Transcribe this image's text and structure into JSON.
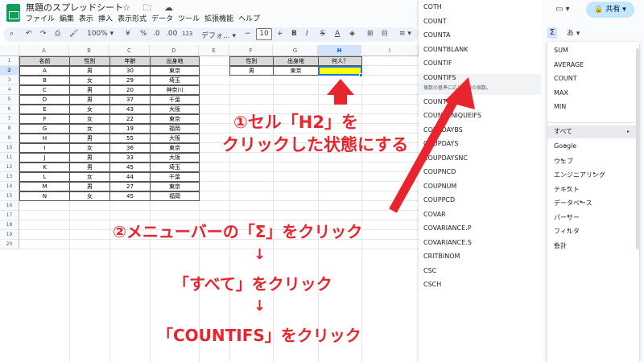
{
  "doc": {
    "title": "無題のスプレッドシート",
    "title_icons": "☆ 🗀 ☁",
    "menus": [
      "ファイル",
      "編集",
      "表示",
      "挿入",
      "表示形式",
      "データ",
      "ツール",
      "拡張機能",
      "ヘルプ"
    ]
  },
  "toolbar": {
    "search_icon": "search-icon",
    "undo": "↶",
    "redo": "↷",
    "zoom": "100%",
    "currency": "¥",
    "percent": "%",
    "dec_minus": ".0",
    "dec_plus": ".00",
    "number_fmt": "123",
    "font": "デフォ...",
    "font_size": "10",
    "minus": "−",
    "plus": "+",
    "bold": "B",
    "italic": "I",
    "strike": "S",
    "text_color": "A"
  },
  "grid": {
    "columns": [
      "A",
      "B",
      "C",
      "D",
      "E",
      "F",
      "G",
      "H",
      "I"
    ],
    "rows": [
      "1",
      "2",
      "3",
      "4",
      "5",
      "6",
      "7",
      "8",
      "9",
      "10",
      "11",
      "12",
      "13",
      "14",
      "15",
      "16",
      "17",
      "18",
      "19",
      "20"
    ],
    "active_column": "H",
    "active_row": "2"
  },
  "table": {
    "headers": [
      "名前",
      "性別",
      "年齢",
      "出身地"
    ],
    "rows": [
      [
        "A",
        "男",
        "30",
        "東京"
      ],
      [
        "B",
        "女",
        "29",
        "埼玉"
      ],
      [
        "C",
        "男",
        "20",
        "神奈川"
      ],
      [
        "D",
        "男",
        "37",
        "千葉"
      ],
      [
        "E",
        "女",
        "43",
        "大阪"
      ],
      [
        "F",
        "女",
        "22",
        "東京"
      ],
      [
        "G",
        "女",
        "19",
        "福岡"
      ],
      [
        "H",
        "男",
        "55",
        "大阪"
      ],
      [
        "I",
        "女",
        "36",
        "東京"
      ],
      [
        "J",
        "男",
        "33",
        "大阪"
      ],
      [
        "K",
        "男",
        "45",
        "埼玉"
      ],
      [
        "L",
        "女",
        "44",
        "千葉"
      ],
      [
        "M",
        "男",
        "27",
        "東京"
      ],
      [
        "N",
        "女",
        "45",
        "福岡"
      ]
    ]
  },
  "criteria": {
    "headers": [
      "性別",
      "出身地",
      "何人？"
    ],
    "values": [
      "男",
      "東京",
      ""
    ]
  },
  "function_list": {
    "items": [
      "COTH",
      "COUNT",
      "COUNTA",
      "COUNTBLANK",
      "COUNTIF",
      "COUNTIFS",
      "COUNTUNIQUE",
      "COUNTUNIQUEIFS",
      "COUPDAYBS",
      "COUPDAYS",
      "COUPDAYSNC",
      "COUPNCD",
      "COUPNUM",
      "COUPPCD",
      "COVAR",
      "COVARIANCE.P",
      "COVARIANCE.S",
      "CRITBINOM",
      "CSC",
      "CSCH"
    ],
    "highlighted": "COUNTIFS",
    "highlighted_desc": "複数の基準に応じた値の個数。"
  },
  "right_panel": {
    "share_label": "共有",
    "sigma": "Σ",
    "input_tool": "あ",
    "quick_functions": [
      "SUM",
      "AVERAGE",
      "COUNT",
      "MAX",
      "MIN"
    ],
    "categories": [
      "すべて",
      "Google",
      "ウェブ",
      "エンジニアリング",
      "テキスト",
      "データベース",
      "パーサー",
      "フィルタ",
      "会計"
    ],
    "active_category": "すべて"
  },
  "annotations": {
    "step1_line1": "①セル「H2」を",
    "step1_line2": "クリックした状態にする",
    "step2": "②メニューバーの「Σ」をクリック",
    "arrow": "↓",
    "step3": "「すべて」をクリック",
    "step4": "「COUNTIFS」をクリック"
  },
  "colors": {
    "annotation_red": "#e8252e",
    "selected_cell": "#ffff00",
    "selection_border": "#1a73e8",
    "header_fill": "#d9d9d9",
    "sheets_green": "#0f9d58"
  }
}
